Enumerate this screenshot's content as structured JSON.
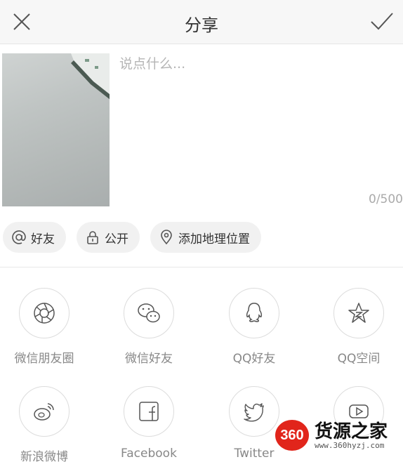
{
  "header": {
    "title": "分享",
    "close_icon": "close-icon",
    "confirm_icon": "checkmark-icon"
  },
  "composer": {
    "placeholder": "说点什么...",
    "counter": "0/500"
  },
  "chips": [
    {
      "icon": "at-icon",
      "label": "好友"
    },
    {
      "icon": "lock-icon",
      "label": "公开"
    },
    {
      "icon": "location-pin-icon",
      "label": "添加地理位置"
    }
  ],
  "share_targets": [
    {
      "icon": "aperture-icon",
      "label": "微信朋友圈"
    },
    {
      "icon": "wechat-icon",
      "label": "微信好友"
    },
    {
      "icon": "qq-icon",
      "label": "QQ好友"
    },
    {
      "icon": "qzone-star-icon",
      "label": "QQ空间"
    },
    {
      "icon": "weibo-icon",
      "label": "新浪微博"
    },
    {
      "icon": "facebook-icon",
      "label": "Facebook"
    },
    {
      "icon": "twitter-icon",
      "label": "Twitter"
    },
    {
      "icon": "youtube-icon",
      "label": ""
    }
  ],
  "watermark": {
    "badge": "360",
    "title": "货源之家",
    "url": "www.360hyzj.com"
  },
  "colors": {
    "icon_stroke": "#555555",
    "watermark_red": "#e1251b"
  }
}
